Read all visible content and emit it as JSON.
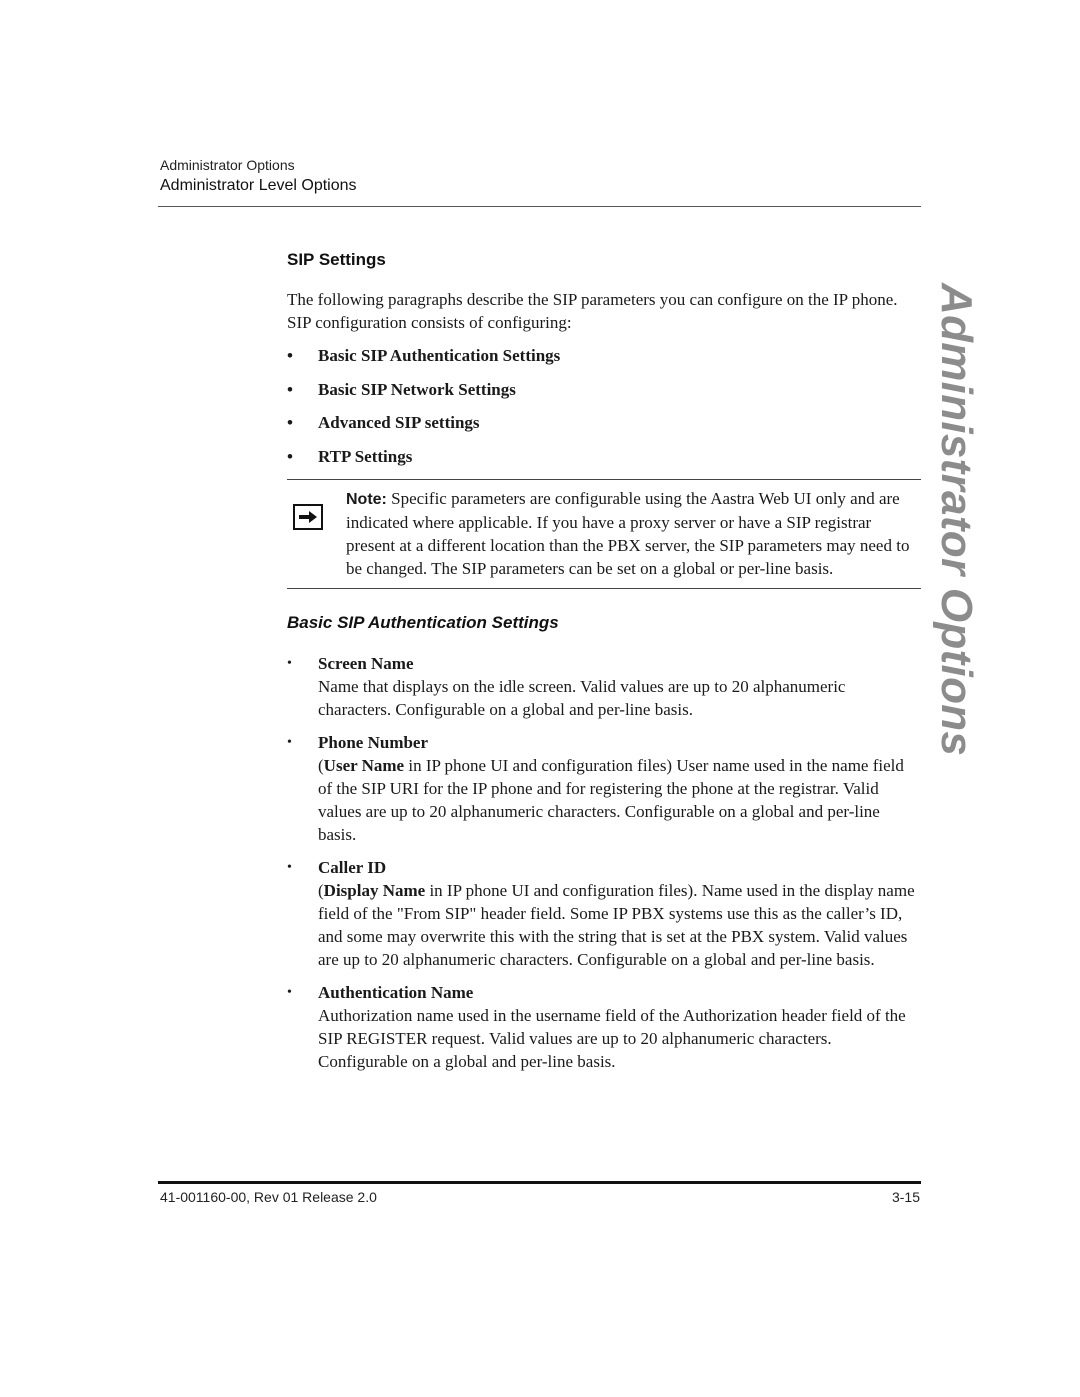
{
  "running_head": {
    "chapter": "Administrator Options",
    "section": "Administrator Level Options"
  },
  "side_tab": {
    "label": "Administrator Options",
    "color": "#8c8c8c"
  },
  "content": {
    "heading": "SIP Settings",
    "intro": "The following paragraphs describe the SIP parameters you can configure on the IP phone. SIP configuration consists of configuring:",
    "bullet_glyph": "•",
    "config_list": [
      "Basic SIP Authentication Settings",
      "Basic SIP Network Settings",
      "Advanced SIP settings",
      "RTP Settings"
    ],
    "note": {
      "icon": "arrow-right-icon",
      "label": "Note:",
      "text": " Specific parameters are configurable using the Aastra Web UI only and are indicated where applicable. If you have a proxy server or have a SIP registrar present at a different location than the PBX server, the SIP parameters may need to be changed. The SIP parameters can be set on a global or per-line basis."
    },
    "subheading": "Basic SIP Authentication Settings",
    "parameters": [
      {
        "term": "Screen Name",
        "desc_prefix_bold": "",
        "desc": "Name that displays on the idle screen. Valid values are up to 20 alphanumeric characters. Configurable on a global and per-line basis."
      },
      {
        "term": "Phone Number",
        "desc_open": "(",
        "desc_prefix_bold": "User Name",
        "desc": " in IP phone UI and configuration files) User name used in the name field of the SIP URI for the IP phone and for registering the phone at the registrar. Valid values are up to 20 alphanumeric characters. Configurable on a global and per-line basis."
      },
      {
        "term": "Caller ID",
        "desc_open": "(",
        "desc_prefix_bold": "Display Name",
        "desc": " in IP phone UI and configuration files). Name used in the display name field of the \"From SIP\" header field. Some IP PBX systems use this as the caller’s ID, and some may overwrite this with the string that is set at the PBX system. Valid values are up to 20 alphanumeric characters. Configurable on a global and per-line basis."
      },
      {
        "term": "Authentication Name",
        "desc_prefix_bold": "",
        "desc": "Authorization name used in the username field of the Authorization header field of the SIP REGISTER request. Valid values are up to 20 alphanumeric characters. Configurable on a global and per-line basis."
      }
    ]
  },
  "footer": {
    "doc_id": "41-001160-00, Rev 01  Release 2.0",
    "page_number": "3-15"
  }
}
